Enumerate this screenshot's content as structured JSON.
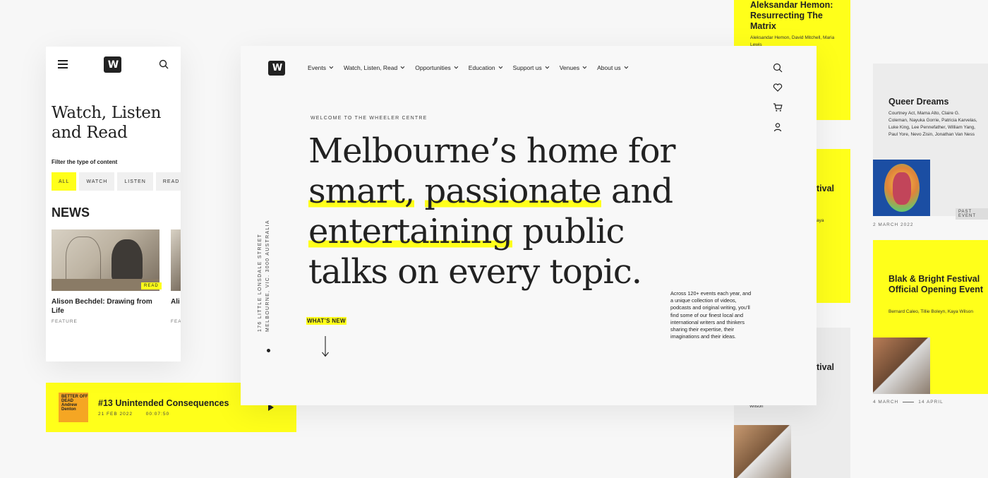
{
  "colors": {
    "accent": "#ffff1a",
    "ink": "#222222",
    "panel": "#ececec"
  },
  "mobile": {
    "logo_text": "W",
    "page_title": "Watch, Listen and Read",
    "filter_label": "Filter the type of content",
    "filters": [
      "ALL",
      "WATCH",
      "LISTEN",
      "READ"
    ],
    "section": "NEWS",
    "card": {
      "tag": "READ",
      "title": "Alison Bechdel: Drawing from Life",
      "type": "FEATURE"
    },
    "card2": {
      "title": "Ali Life",
      "type": "FEA"
    }
  },
  "podcast": {
    "art_text": "BETTER OFF DEAD Andrew Denton",
    "title": "#13 Unintended Consequences",
    "date": "21 FEB 2022",
    "duration": "00:07:50"
  },
  "events": {
    "hemon": {
      "title": "Aleksandar Hemon: Resurrecting The Matrix",
      "people": "Aleksandar Hemon, David Mitchell, Maria Lewis"
    },
    "card2": {
      "title_fragment": "tival",
      "people_fragment": "aya"
    },
    "card3": {
      "title_fragment": "tival",
      "people_fragment": "Wilson"
    },
    "queer": {
      "title": "Queer Dreams",
      "people": "Courtney Act, Mama Alto, Claire G. Coleman, Nayuka Gorrie, Patricia Karvelas, Luke King, Lee Pennefather, William Yang, Paul Yore, Nevo Zisin, Jonathan Van Ness",
      "tag": "PAST EVENT",
      "date": "2 MARCH 2022"
    },
    "blak": {
      "title": "Blak & Bright Festival Official Opening Event",
      "people": "Bernard Caleo, Tillie Boleyn, Kaya Wilson",
      "date_start": "4 MARCH",
      "date_end": "14 APRIL"
    }
  },
  "desktop": {
    "logo_text": "W",
    "nav": [
      "Events",
      "Watch, Listen, Read",
      "Opportunities",
      "Education",
      "Support us",
      "Venues",
      "About us"
    ],
    "icons": [
      "search-icon",
      "heart-icon",
      "cart-icon",
      "user-icon"
    ],
    "welcome": "WELCOME TO THE WHEELER CENTRE",
    "headline": {
      "l1": "Melbourne’s home for",
      "l2a": "smart,",
      "l2b": "passionate",
      "l2c": "and",
      "l3a": "entertaining",
      "l3b": "public",
      "l4": "talks on every topic."
    },
    "address": "176 LITTLE LONSDALE STREET MELBOURNE, VIC. 3000 AUSTRALIA",
    "whats_new": "WHAT’S NEW",
    "blurb": "Across 120+ events each year, and a unique collection of videos, podcasts and original writing, you’ll find some of our finest local and international writers and thinkers sharing their expertise, their imaginations and their ideas."
  }
}
